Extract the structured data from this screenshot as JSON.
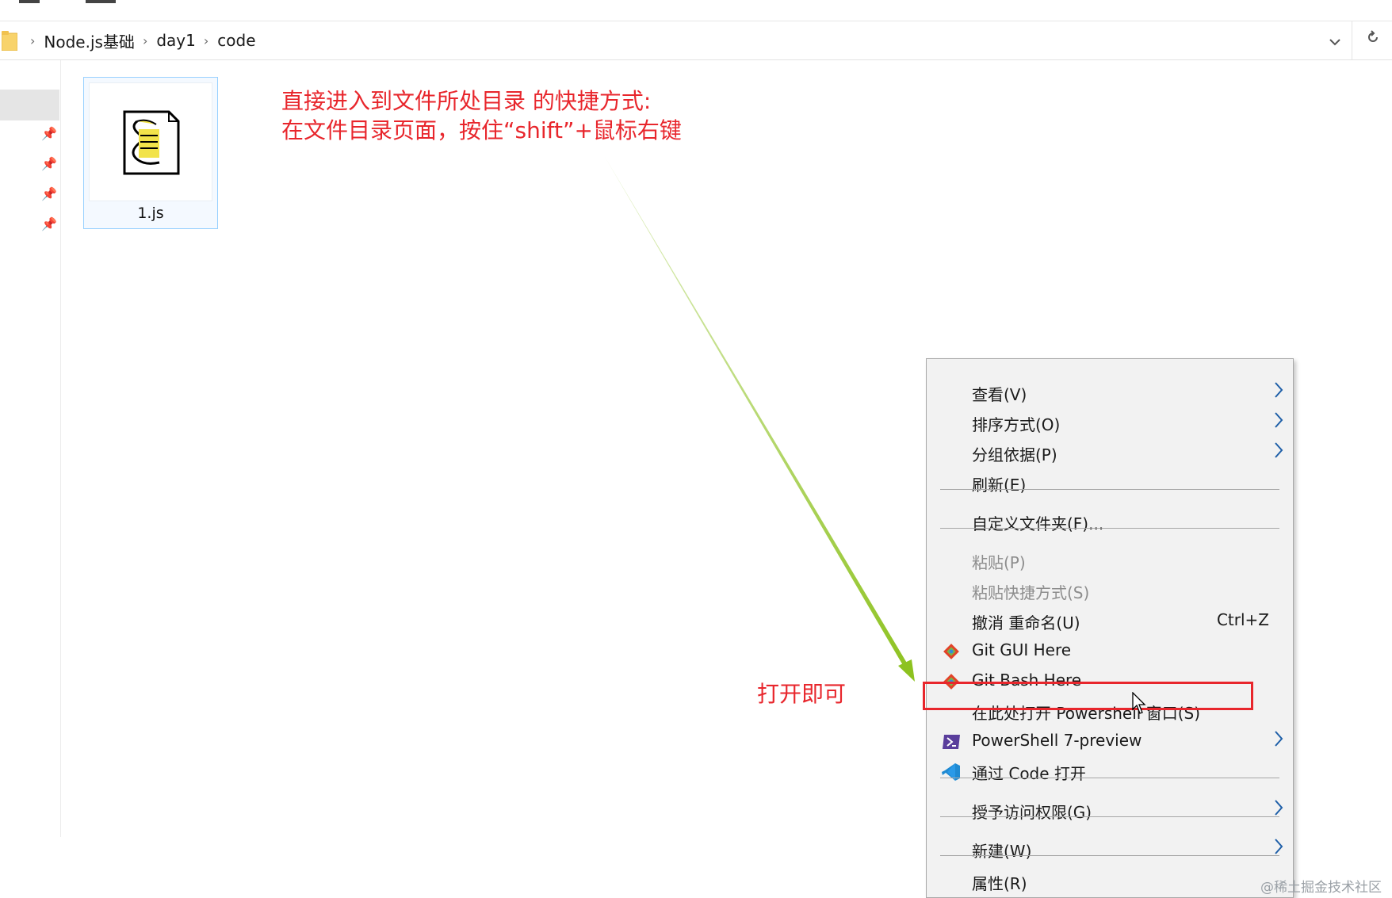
{
  "address_bar": {
    "breadcrumbs": [
      "Node.js基础",
      "day1",
      "code"
    ]
  },
  "file": {
    "name": "1.js"
  },
  "annotations": {
    "line1": "直接进入到文件所处目录 的快捷方式:",
    "line2": "在文件目录页面，按住“shift”+鼠标右键",
    "open_hint": "打开即可"
  },
  "context_menu": {
    "items": [
      {
        "label": "查看(V)",
        "submenu": true
      },
      {
        "label": "排序方式(O)",
        "submenu": true
      },
      {
        "label": "分组依据(P)",
        "submenu": true
      },
      {
        "label": "刷新(E)"
      },
      {
        "label": "自定义文件夹(F)..."
      },
      {
        "label": "粘贴(P)",
        "disabled": true
      },
      {
        "label": "粘贴快捷方式(S)",
        "disabled": true
      },
      {
        "label": "撤消 重命名(U)",
        "shortcut": "Ctrl+Z"
      },
      {
        "label": "Git GUI Here",
        "icon": "git-icon"
      },
      {
        "label": "Git Bash Here",
        "icon": "git-icon"
      },
      {
        "label": "在此处打开 Powershell 窗口(S)",
        "highlighted": true
      },
      {
        "label": "PowerShell 7-preview",
        "icon": "powershell-icon",
        "submenu": true
      },
      {
        "label": "通过 Code 打开",
        "icon": "vscode-icon"
      },
      {
        "label": "授予访问权限(G)",
        "submenu": true
      },
      {
        "label": "新建(W)",
        "submenu": true
      },
      {
        "label": "属性(R)"
      }
    ]
  },
  "watermark": "@稀土掘金技术社区",
  "colors": {
    "annotation_red": "#e8262c",
    "arrow_green": "#8dc21f",
    "selection_blue": "#99d1ff"
  }
}
